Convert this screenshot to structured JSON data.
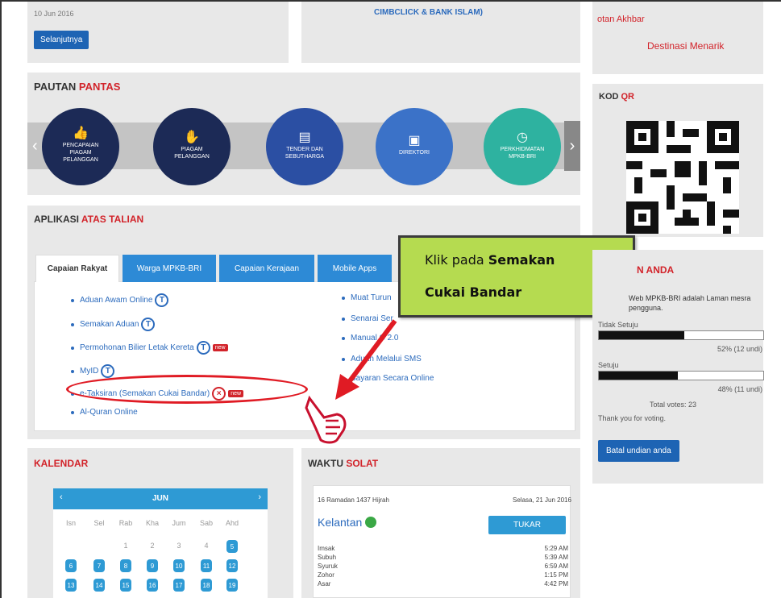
{
  "news": {
    "date": "10 Jun 2016",
    "read_more": "Selanjutnya"
  },
  "middle_top": {
    "text": "CIMBCLICK & BANK ISLAM)"
  },
  "right_top": {
    "line1": "otan Akhbar",
    "line2": "Destinasi Menarik"
  },
  "pautan": {
    "title_a": "PAUTAN ",
    "title_b": "PANTAS",
    "items": [
      {
        "label": "PENCAPAIAN PIAGAM PELANGGAN",
        "icon": "thumbs-up-icon",
        "color": "#1c2a56"
      },
      {
        "label": "PIAGAM PELANGGAN",
        "icon": "handshake-icon",
        "color": "#1c2a56"
      },
      {
        "label": "TENDER DAN SEBUTHARGA",
        "icon": "document-icon",
        "color": "#2b4fa3"
      },
      {
        "label": "DIREKTORI",
        "icon": "directory-icon",
        "color": "#3b72c8"
      },
      {
        "label": "PERKHIDMATAN MPKB-BRI",
        "icon": "clock-icon",
        "color": "#2eb2a0"
      }
    ]
  },
  "kod_qr": {
    "title_a": "KOD ",
    "title_b": "QR"
  },
  "aplikasi": {
    "title_a": "APLIKASI ",
    "title_b": "ATAS TALIAN",
    "tabs": [
      "Capaian Rakyat",
      "Warga MPKB-BRI",
      "Capaian Kerajaan",
      "Mobile Apps"
    ],
    "left_links": [
      "Aduan Awam Online",
      "Semakan Aduan",
      "Permohonan Bilier Letak Kereta",
      "MyID",
      "e-Taksiran (Semakan Cukai Bandar)",
      "Al-Quran Online"
    ],
    "right_links": [
      "Muat Turun",
      "Senarai Ser",
      "Manual C 2.0",
      "Aduan Melalui SMS",
      "Bayaran Secara Online"
    ],
    "badge_new": "new"
  },
  "callout": {
    "prefix": "Klik pada ",
    "bold1": "Semakan",
    "bold2": "Cukai Bandar"
  },
  "undian": {
    "title": "N ANDA",
    "desc": "Web MPKB-BRI adalah Laman mesra pengguna.",
    "opt1_label": "Tidak Setuju",
    "opt1_pct": 0.52,
    "opt1_text": "52% (12 undi)",
    "opt2_label": "Setuju",
    "opt2_pct": 0.48,
    "opt2_text": "48% (11 undi)",
    "total": "Total votes: 23",
    "thanks": "Thank you for voting.",
    "btn": "Batal undian anda"
  },
  "kalendar": {
    "title": "KALENDAR",
    "month": "JUN",
    "days": [
      "Isn",
      "Sel",
      "Rab",
      "Kha",
      "Jum",
      "Sab",
      "Ahd"
    ],
    "row1": [
      "",
      "",
      "1",
      "2",
      "3",
      "4",
      "5"
    ],
    "row2": [
      "6",
      "7",
      "8",
      "9",
      "10",
      "11",
      "12"
    ],
    "row3": [
      "13",
      "14",
      "15",
      "16",
      "17",
      "18",
      "19"
    ]
  },
  "solat": {
    "title_a": "WAKTU ",
    "title_b": "SOLAT",
    "hijri": "16 Ramadan 1437 Hijrah",
    "date": "Selasa, 21 Jun 2016",
    "state": "Kelantan",
    "change_btn": "TUKAR",
    "names": [
      "Imsak",
      "Subuh",
      "Syuruk",
      "Zohor",
      "Asar"
    ],
    "times": [
      "5:29 AM",
      "5:39 AM",
      "6:59 AM",
      "1:15 PM",
      "4:42 PM"
    ]
  }
}
